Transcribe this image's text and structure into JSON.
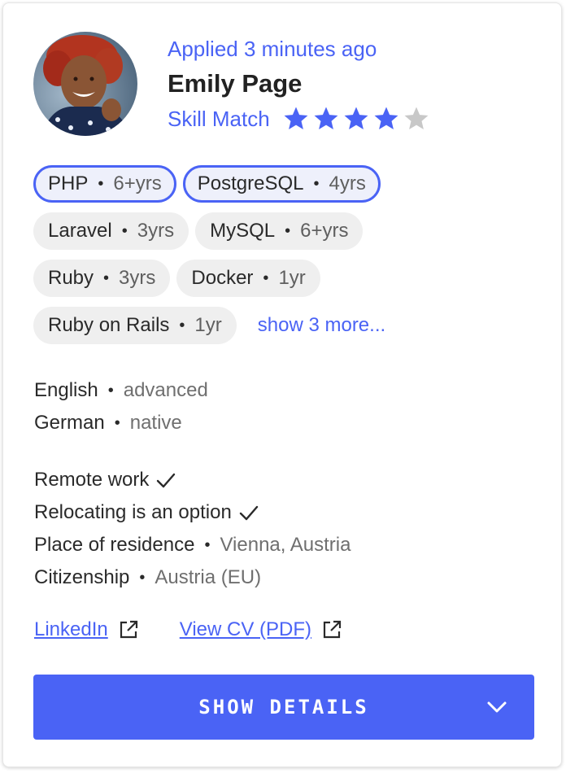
{
  "candidate": {
    "applied": "Applied 3 minutes ago",
    "name": "Emily Page",
    "skill_match_label": "Skill Match",
    "skill_match_rating": 4,
    "skill_match_max": 5
  },
  "skills": [
    {
      "skill": "PHP",
      "years": "6+yrs",
      "highlighted": true
    },
    {
      "skill": "PostgreSQL",
      "years": "4yrs",
      "highlighted": true
    },
    {
      "skill": "Laravel",
      "years": "3yrs",
      "highlighted": false
    },
    {
      "skill": "MySQL",
      "years": "6+yrs",
      "highlighted": false
    },
    {
      "skill": "Ruby",
      "years": "3yrs",
      "highlighted": false
    },
    {
      "skill": "Docker",
      "years": "1yr",
      "highlighted": false
    },
    {
      "skill": "Ruby on Rails",
      "years": "1yr",
      "highlighted": false
    }
  ],
  "show_more": "show 3 more...",
  "languages": [
    {
      "language": "English",
      "level": "advanced"
    },
    {
      "language": "German",
      "level": "native"
    }
  ],
  "preferences": {
    "remote_work": "Remote work",
    "relocating": "Relocating is an option",
    "residence_label": "Place of residence",
    "residence_value": "Vienna, Austria",
    "citizenship_label": "Citizenship",
    "citizenship_value": "Austria (EU)"
  },
  "links": {
    "linkedin": "LinkedIn",
    "cv": "View CV (PDF)"
  },
  "action": {
    "show_details": "SHOW DETAILS"
  },
  "colors": {
    "accent": "#4a63f5",
    "star_on": "#4a63f5",
    "star_off": "#c8c8c8",
    "chip_bg": "#efefef"
  },
  "icons": [
    "star-icon",
    "check-icon",
    "external-link-icon",
    "chevron-down-icon"
  ]
}
